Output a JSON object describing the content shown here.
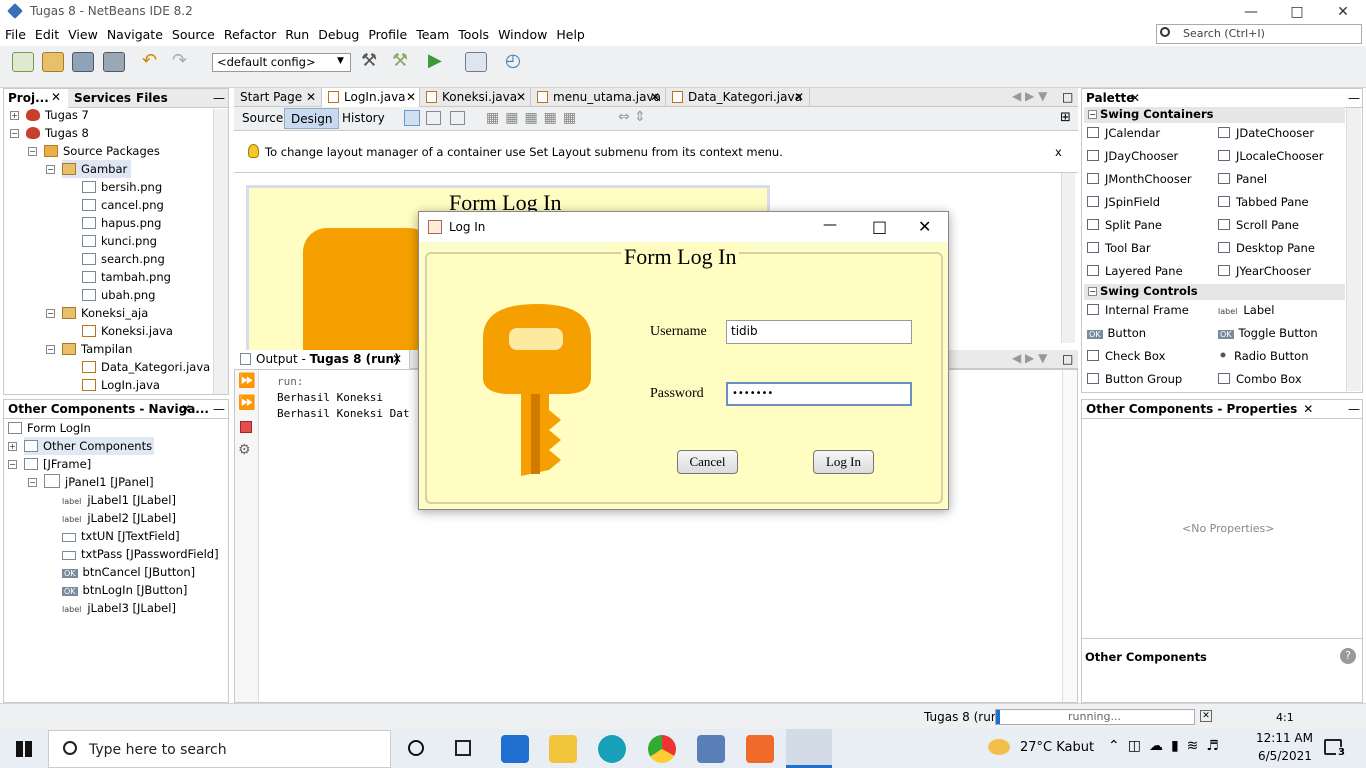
{
  "window": {
    "title": "Tugas 8 - NetBeans IDE 8.2"
  },
  "menu": [
    "File",
    "Edit",
    "View",
    "Navigate",
    "Source",
    "Refactor",
    "Run",
    "Debug",
    "Profile",
    "Team",
    "Tools",
    "Window",
    "Help"
  ],
  "search": {
    "placeholder": "Search (Ctrl+I)"
  },
  "toolbar": {
    "config": "<default config>"
  },
  "projects": {
    "tabs": [
      "Proj...",
      "Services",
      "Files"
    ],
    "tree": [
      "Tugas 7",
      "Tugas 8",
      "Source Packages",
      "Gambar",
      "bersih.png",
      "cancel.png",
      "hapus.png",
      "kunci.png",
      "search.png",
      "tambah.png",
      "ubah.png",
      "Koneksi_aja",
      "Koneksi.java",
      "Tampilan",
      "Data_Kategori.java",
      "LogIn.java"
    ]
  },
  "navigator": {
    "title": "Other Components - Naviga...",
    "items": [
      "Form LogIn",
      "Other Components",
      "[JFrame]",
      "jPanel1 [JPanel]",
      "jLabel1 [JLabel]",
      "jLabel2 [JLabel]",
      "txtUN [JTextField]",
      "txtPass [JPasswordField]",
      "btnCancel [JButton]",
      "btnLogIn [JButton]",
      "jLabel3 [JLabel]"
    ],
    "badges": {
      "label": "label",
      "ok": "OK"
    }
  },
  "editor": {
    "tabs": [
      "Start Page",
      "LogIn.java",
      "Koneksi.java",
      "menu_utama.java",
      "Data_Kategori.java"
    ],
    "views": [
      "Source",
      "Design",
      "History"
    ],
    "hint": "To change layout manager of a container use Set Layout submenu from its context menu.",
    "hint_close": "x",
    "design_title": "Form Log In"
  },
  "output": {
    "tab_prefix": "Output - ",
    "tab_bold": "Tugas 8 (run)",
    "lines": [
      "run:",
      "Berhasil Koneksi",
      "Berhasil Koneksi Dat"
    ]
  },
  "palette": {
    "title": "Palette",
    "sections": [
      "Swing Containers",
      "Swing Controls"
    ],
    "containers": [
      "JCalendar",
      "JDateChooser",
      "JDayChooser",
      "JLocaleChooser",
      "JMonthChooser",
      "Panel",
      "JSpinField",
      "Tabbed Pane",
      "Split Pane",
      "Scroll Pane",
      "Tool Bar",
      "Desktop Pane",
      "Layered Pane",
      "JYearChooser"
    ],
    "controls": [
      "Internal Frame",
      "Label",
      "Button",
      "Toggle Button",
      "Check Box",
      "Radio Button",
      "Button Group",
      "Combo Box"
    ],
    "control_badges": {
      "label": "label",
      "ok": "OK"
    }
  },
  "properties": {
    "title": "Other Components - Properties",
    "empty": "<No Properties>",
    "footer": "Other Components"
  },
  "dialog": {
    "title": "Log In",
    "heading": "Form Log In",
    "username_label": "Username",
    "username_value": "tidib",
    "password_label": "Password",
    "password_value": "•••••••",
    "cancel": "Cancel",
    "login": "Log In"
  },
  "status": {
    "project": "Tugas 8 (run)",
    "progress": "running...",
    "position": "4:1"
  },
  "taskbar": {
    "search": "Type here to search",
    "weather": "27°C  Kabut",
    "time": "12:11 AM",
    "date": "6/5/2021",
    "notifications": "3"
  },
  "colors": {
    "dialog_bg": "#fffdc2",
    "key": "#f5a000",
    "accent": "#1e6fd0"
  }
}
